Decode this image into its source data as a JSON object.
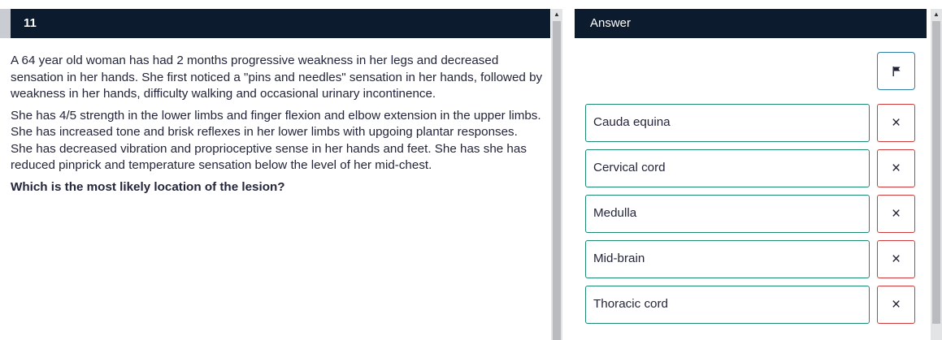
{
  "question": {
    "number": "11",
    "paragraphs": [
      "A 64 year old woman has had 2 months progressive weakness in her legs and decreased sensation in her hands. She first noticed a \"pins and needles\" sensation in her hands, followed by weakness in her hands, difficulty walking and occasional urinary incontinence.",
      "She has 4/5 strength in the lower limbs and finger flexion and elbow extension in the upper limbs. She has increased tone and brisk reflexes in her lower limbs with upgoing plantar responses. She has decreased vibration and proprioceptive sense in her hands and feet. She has she has reduced pinprick and temperature sensation below the level of her mid-chest."
    ],
    "prompt": "Which is the most likely location of the lesion?"
  },
  "answer": {
    "title": "Answer",
    "flag_icon": "flag-icon",
    "options": [
      {
        "label": "Cauda equina",
        "strike": "×"
      },
      {
        "label": "Cervical cord",
        "strike": "×"
      },
      {
        "label": "Medulla",
        "strike": "×"
      },
      {
        "label": "Mid-brain",
        "strike": "×"
      },
      {
        "label": "Thoracic cord",
        "strike": "×"
      }
    ]
  },
  "scrollbars": {
    "up_arrow": "▲"
  },
  "colors": {
    "header_bg": "#0d1b2e",
    "option_border": "#1e8a6e",
    "strike_border": "#cf3a3a",
    "flag_border": "#2f7fa8"
  }
}
